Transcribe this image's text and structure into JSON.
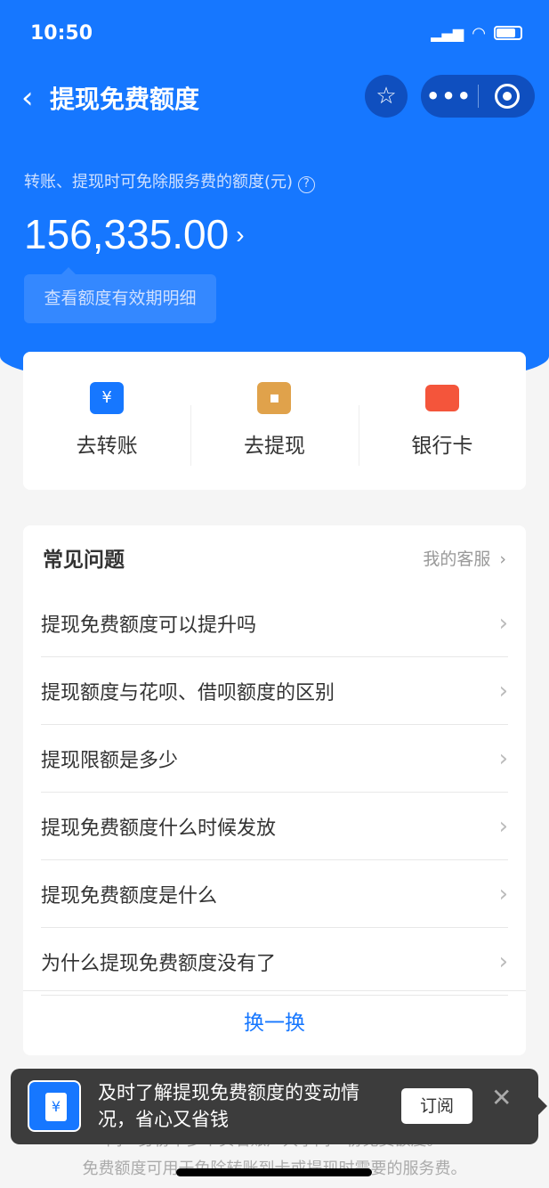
{
  "status": {
    "time": "10:50"
  },
  "nav": {
    "title": "提现免费额度",
    "back_icon": "chevron-left-icon",
    "more": "•••"
  },
  "header": {
    "subtitle": "转账、提现时可免除服务费的额度(元)",
    "amount": "156,335.00",
    "tip": "查看额度有效期明细"
  },
  "quick": [
    {
      "label": "去转账",
      "icon": "transfer-icon",
      "color": "#1677ff"
    },
    {
      "label": "去提现",
      "icon": "wallet-icon",
      "color": "#e0a24b"
    },
    {
      "label": "银行卡",
      "icon": "bank-card-icon",
      "color": "#f4553b"
    }
  ],
  "faq": {
    "title": "常见问题",
    "service": "我的客服",
    "items": [
      "提现免费额度可以提升吗",
      "提现额度与花呗、借呗额度的区别",
      "提现限额是多少",
      "提现免费额度什么时候发放",
      "提现免费额度是什么",
      "为什么提现免费额度没有了"
    ],
    "swap": "换一换"
  },
  "footer": [
    "同一身份下多个实名账户共享同一份免费额度。",
    "免费额度可用于免除转账到卡或提现时需要的服务费。"
  ],
  "toast": {
    "text": "及时了解提现免费额度的变动情况，省心又省钱",
    "subscribe": "订阅",
    "icon_glyph": "¥"
  },
  "colors": {
    "brand": "#1677ff"
  }
}
